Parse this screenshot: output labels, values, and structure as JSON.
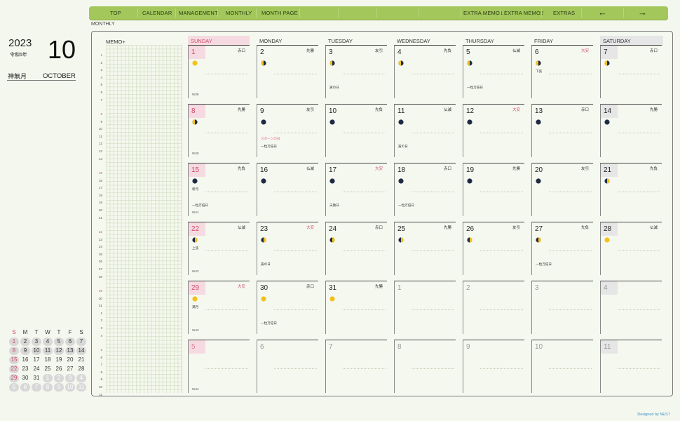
{
  "nav": {
    "items": [
      "TOP",
      "CALENDAR",
      "MANAGEMENT",
      "MONTHLY",
      "MONTH PAGE",
      "EXTRA MEMO1",
      "EXTRA MEMO2",
      "EXTRAS"
    ],
    "prev": "←",
    "next": "→"
  },
  "section_label": "MONTHLY",
  "month_info": {
    "year": "2023",
    "era": "令和5年",
    "month": "10",
    "jp_month": "神無月",
    "en_month": "OCTOBER"
  },
  "memo": {
    "title": "MEMO+",
    "line_numbers": [
      "1",
      "2",
      "3",
      "4",
      "5",
      "6",
      "7",
      "8",
      "9",
      "10",
      "11",
      "12",
      "13",
      "14",
      "15",
      "16",
      "17",
      "18",
      "19",
      "20",
      "21",
      "22",
      "23",
      "24",
      "25",
      "26",
      "27",
      "28",
      "29",
      "30",
      "31",
      "1",
      "2",
      "3",
      "4",
      "5",
      "6",
      "7",
      "8",
      "9",
      "10",
      "11"
    ]
  },
  "weekdays": [
    "SUNDAY",
    "MONDAY",
    "TUESDAY",
    "WEDNESDAY",
    "THURSDAY",
    "FRIDAY",
    "SATURDAY"
  ],
  "weeks": [
    {
      "label": "W39",
      "days": [
        {
          "n": "1",
          "r": "赤口",
          "m": "full",
          "notes": []
        },
        {
          "n": "2",
          "r": "先勝",
          "m": "wane",
          "notes": []
        },
        {
          "n": "3",
          "r": "友引",
          "m": "wane",
          "notes": [
            {
              "t": "寅の日",
              "y": 57
            }
          ]
        },
        {
          "n": "4",
          "r": "先負",
          "m": "wane",
          "notes": []
        },
        {
          "n": "5",
          "r": "仏滅",
          "m": "wane",
          "notes": [
            {
              "t": "一粒万倍日",
              "y": 57
            }
          ]
        },
        {
          "n": "6",
          "r": "大安",
          "red": true,
          "m": "wane",
          "notes": [
            {
              "t": "下弦",
              "y": 34
            }
          ]
        },
        {
          "n": "7",
          "r": "赤口",
          "m": "wane",
          "notes": []
        }
      ]
    },
    {
      "label": "W40",
      "days": [
        {
          "n": "8",
          "r": "先勝",
          "m": "wane",
          "notes": []
        },
        {
          "n": "9",
          "r": "友引",
          "m": "new",
          "notes": [
            {
              "t": "スポーツの日",
              "y": 46,
              "pink": true
            },
            {
              "t": "一粒万倍日",
              "y": 57
            }
          ]
        },
        {
          "n": "10",
          "r": "先負",
          "m": "new",
          "notes": []
        },
        {
          "n": "11",
          "r": "仏滅",
          "m": "new",
          "notes": [
            {
              "t": "寅の日",
              "y": 57
            }
          ]
        },
        {
          "n": "12",
          "r": "大安",
          "red": true,
          "m": "new",
          "notes": []
        },
        {
          "n": "13",
          "r": "赤口",
          "m": "new",
          "notes": []
        },
        {
          "n": "14",
          "r": "先勝",
          "m": "new",
          "notes": []
        }
      ]
    },
    {
      "label": "W41",
      "days": [
        {
          "n": "15",
          "r": "先負",
          "m": "new",
          "notes": [
            {
              "t": "新月",
              "y": 34
            },
            {
              "t": "一粒万倍日",
              "y": 57
            }
          ]
        },
        {
          "n": "16",
          "r": "仏滅",
          "m": "new",
          "notes": []
        },
        {
          "n": "17",
          "r": "大安",
          "red": true,
          "m": "new",
          "notes": [
            {
              "t": "天赦日",
              "y": 57
            }
          ]
        },
        {
          "n": "18",
          "r": "赤口",
          "m": "new",
          "notes": [
            {
              "t": "一粒万倍日",
              "y": 57
            }
          ]
        },
        {
          "n": "19",
          "r": "先勝",
          "m": "new",
          "notes": []
        },
        {
          "n": "20",
          "r": "友引",
          "m": "new",
          "notes": []
        },
        {
          "n": "21",
          "r": "先負",
          "m": "wax",
          "notes": []
        }
      ]
    },
    {
      "label": "W42",
      "days": [
        {
          "n": "22",
          "r": "仏滅",
          "m": "wax",
          "notes": [
            {
              "t": "上弦",
              "y": 34
            }
          ]
        },
        {
          "n": "23",
          "r": "大安",
          "red": true,
          "m": "wax",
          "notes": [
            {
              "t": "寅の日",
              "y": 57
            }
          ]
        },
        {
          "n": "24",
          "r": "赤口",
          "m": "wax",
          "notes": []
        },
        {
          "n": "25",
          "r": "先勝",
          "m": "wax",
          "notes": []
        },
        {
          "n": "26",
          "r": "友引",
          "m": "wax",
          "notes": []
        },
        {
          "n": "27",
          "r": "先負",
          "m": "wax",
          "notes": [
            {
              "t": "一粒万倍日",
              "y": 57
            }
          ]
        },
        {
          "n": "28",
          "r": "仏滅",
          "m": "full",
          "notes": []
        }
      ]
    },
    {
      "label": "W43",
      "days": [
        {
          "n": "29",
          "r": "大安",
          "red": true,
          "m": "full",
          "notes": [
            {
              "t": "満月",
              "y": 34
            }
          ]
        },
        {
          "n": "30",
          "r": "赤口",
          "m": "full",
          "notes": [
            {
              "t": "一粒万倍日",
              "y": 57
            }
          ]
        },
        {
          "n": "31",
          "r": "先勝",
          "m": "full",
          "notes": []
        },
        {
          "n": "1",
          "out": true
        },
        {
          "n": "2",
          "out": true
        },
        {
          "n": "3",
          "out": true
        },
        {
          "n": "4",
          "out": true
        }
      ]
    },
    {
      "label": "W44",
      "days": [
        {
          "n": "5",
          "out": true
        },
        {
          "n": "6",
          "out": true
        },
        {
          "n": "7",
          "out": true
        },
        {
          "n": "8",
          "out": true
        },
        {
          "n": "9",
          "out": true
        },
        {
          "n": "10",
          "out": true
        },
        {
          "n": "11",
          "out": true
        }
      ]
    }
  ],
  "mini_calendar": {
    "headers": [
      "S",
      "M",
      "T",
      "W",
      "T",
      "F",
      "S"
    ],
    "rows": [
      [
        {
          "d": "1",
          "g": true
        },
        {
          "d": "2",
          "g": true
        },
        {
          "d": "3",
          "g": true
        },
        {
          "d": "4",
          "g": true
        },
        {
          "d": "5",
          "g": true
        },
        {
          "d": "6",
          "g": true
        },
        {
          "d": "7",
          "g": true
        }
      ],
      [
        {
          "d": "8",
          "g": true
        },
        {
          "d": "9",
          "g": true
        },
        {
          "d": "10",
          "g": true
        },
        {
          "d": "11",
          "g": true
        },
        {
          "d": "12",
          "g": true
        },
        {
          "d": "13",
          "g": true
        },
        {
          "d": "14",
          "g": true
        }
      ],
      [
        {
          "d": "15",
          "g": true
        },
        {
          "d": "16"
        },
        {
          "d": "17"
        },
        {
          "d": "18"
        },
        {
          "d": "19"
        },
        {
          "d": "20"
        },
        {
          "d": "21"
        }
      ],
      [
        {
          "d": "22",
          "g": true
        },
        {
          "d": "23"
        },
        {
          "d": "24"
        },
        {
          "d": "25"
        },
        {
          "d": "26"
        },
        {
          "d": "27"
        },
        {
          "d": "28"
        }
      ],
      [
        {
          "d": "29",
          "g": true
        },
        {
          "d": "30"
        },
        {
          "d": "31"
        },
        {
          "d": "1",
          "out": true
        },
        {
          "d": "2",
          "out": true
        },
        {
          "d": "3",
          "out": true
        },
        {
          "d": "4",
          "out": true
        }
      ],
      [
        {
          "d": "5",
          "out": true
        },
        {
          "d": "6",
          "out": true
        },
        {
          "d": "7",
          "out": true
        },
        {
          "d": "8",
          "out": true
        },
        {
          "d": "9",
          "out": true
        },
        {
          "d": "10",
          "out": true
        },
        {
          "d": "11",
          "out": true
        }
      ]
    ]
  },
  "credit": "Designed by NEST",
  "colors": {
    "nav_green": "#a3c75b",
    "sunday_pink": "#f5dbe1",
    "sunday_text": "#d24a6a",
    "saturday_gray": "#e6e6e6",
    "background": "#f4f7ee"
  }
}
